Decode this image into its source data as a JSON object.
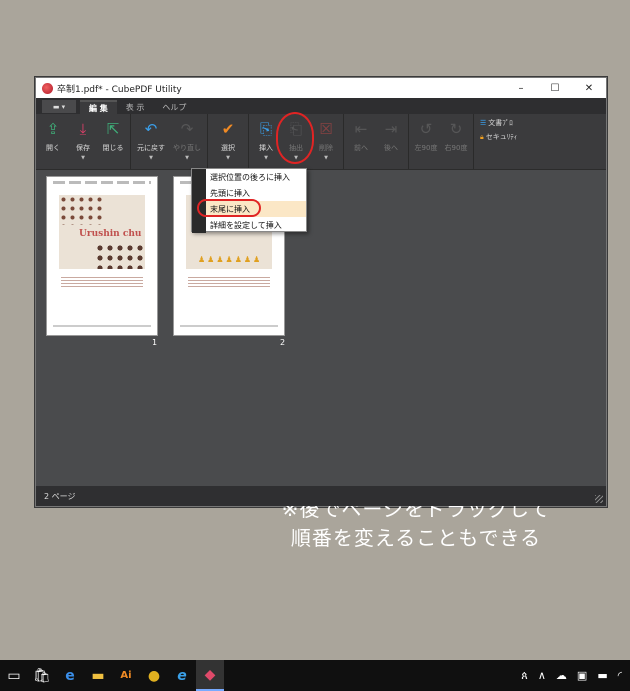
{
  "window": {
    "title": "卒制1.pdf* - CubePDF Utility",
    "minimize": "–",
    "maximize": "☐",
    "close": "✕"
  },
  "tabs": {
    "file": "▬ ▾",
    "edit": "編 集",
    "view": "表 示",
    "help": "ヘルプ"
  },
  "ribbon": {
    "open": "開く",
    "save": "保存",
    "close": "閉じる",
    "undo": "元に戻す",
    "redo": "やり直し",
    "select": "選択",
    "insert": "挿入",
    "extract": "抽出",
    "delete": "削除",
    "prev": "前へ",
    "next": "後へ",
    "rotate_left": "左90度",
    "rotate_right": "右90度",
    "doc_prop": "文書ﾌﾟﾛ",
    "security": "セキュﾘﾃｨ"
  },
  "insert_menu": {
    "items": [
      "選択位置の後ろに挿入",
      "先頭に挿入",
      "末尾に挿入",
      "詳細を設定して挿入"
    ]
  },
  "pages": [
    {
      "number": "1",
      "title": "Urushin chu"
    },
    {
      "number": "2",
      "title": ""
    }
  ],
  "annotation": {
    "line1": "※後でページをドラッグして",
    "line2": "順番を変えることもできる"
  },
  "status": {
    "page_count": "2 ページ"
  },
  "taskbar": {
    "tray_person": "ጰ",
    "tray_arrow": "∧"
  },
  "colors": {
    "accent_red": "#e02424",
    "menu_hover": "#fbe7c6"
  }
}
